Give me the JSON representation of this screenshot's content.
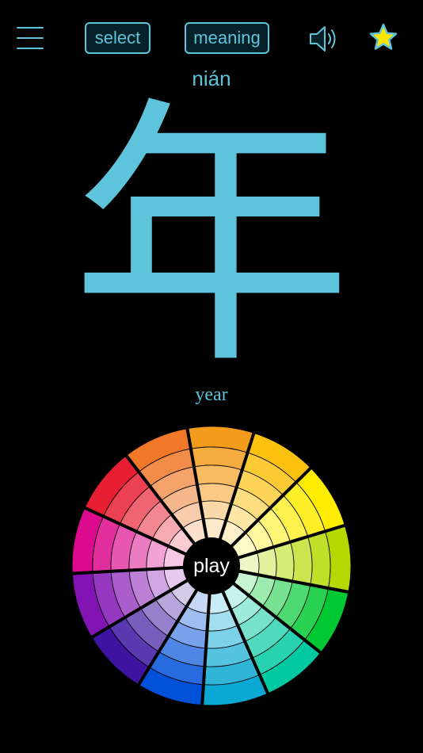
{
  "header": {
    "menu_icon": "hamburger-menu-icon",
    "select_label": "select",
    "meaning_label": "meaning",
    "speaker_icon": "speaker-icon",
    "star_icon": "star-icon"
  },
  "character": {
    "pinyin": "nián",
    "hanzi": "年",
    "meaning": "year"
  },
  "wheel": {
    "play_label": "play",
    "segments": [
      "#f39c1c",
      "#fcc10f",
      "#ffec00",
      "#b5d900",
      "#00c832",
      "#00c8a0",
      "#0aa8d2",
      "#0050d8",
      "#3c14a0",
      "#8214b4",
      "#dc0a8c",
      "#e81e32",
      "#f07828"
    ],
    "colors": {
      "accent": "#5ec4dc",
      "star_fill": "#ffe600",
      "divider": "#000000"
    }
  }
}
